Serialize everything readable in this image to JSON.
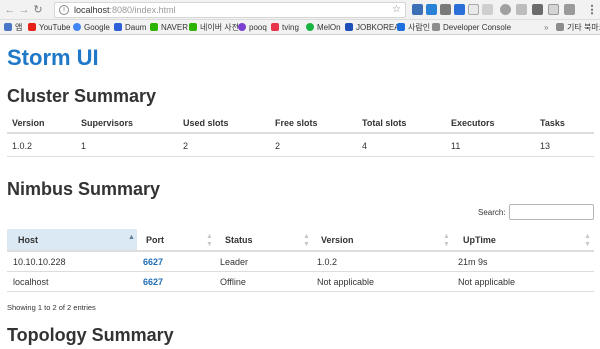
{
  "browser": {
    "url_host": "localhost",
    "url_rest": ":8080/index.html",
    "bookmarks": [
      {
        "label": "앱",
        "color": "#4a76c9"
      },
      {
        "label": "YouTube",
        "color": "#e62117"
      },
      {
        "label": "Google",
        "color": "#4285f4"
      },
      {
        "label": "Daum",
        "color": "#2d5fd8"
      },
      {
        "label": "NAVER",
        "color": "#2db400"
      },
      {
        "label": "네이버 사전",
        "color": "#2db400"
      },
      {
        "label": "pooq",
        "color": "#7b3fd1"
      },
      {
        "label": "tving",
        "color": "#e8334a"
      },
      {
        "label": "MelOn",
        "color": "#1ab540"
      },
      {
        "label": "JOBKOREA",
        "color": "#1e4fb8"
      },
      {
        "label": "사람인",
        "color": "#1d6fe0"
      },
      {
        "label": "Developer Console",
        "color": "#8d8d8d"
      }
    ],
    "other_bookmarks": "기타 북마크"
  },
  "page": {
    "title": "Storm UI"
  },
  "cluster_summary": {
    "heading": "Cluster Summary",
    "columns": [
      "Version",
      "Supervisors",
      "Used slots",
      "Free slots",
      "Total slots",
      "Executors",
      "Tasks"
    ],
    "values": [
      "1.0.2",
      "1",
      "2",
      "2",
      "4",
      "11",
      "13"
    ]
  },
  "nimbus_summary": {
    "heading": "Nimbus Summary",
    "search_label": "Search:",
    "search_value": "",
    "columns": [
      "Host",
      "Port",
      "Status",
      "Version",
      "UpTime"
    ],
    "rows": [
      [
        "10.10.10.228",
        "6627",
        "Leader",
        "1.0.2",
        "21m 9s"
      ],
      [
        "localhost",
        "6627",
        "Offline",
        "Not applicable",
        "Not applicable"
      ]
    ],
    "info": "Showing 1 to 2 of 2 entries"
  },
  "topology_summary": {
    "heading": "Topology Summary"
  }
}
